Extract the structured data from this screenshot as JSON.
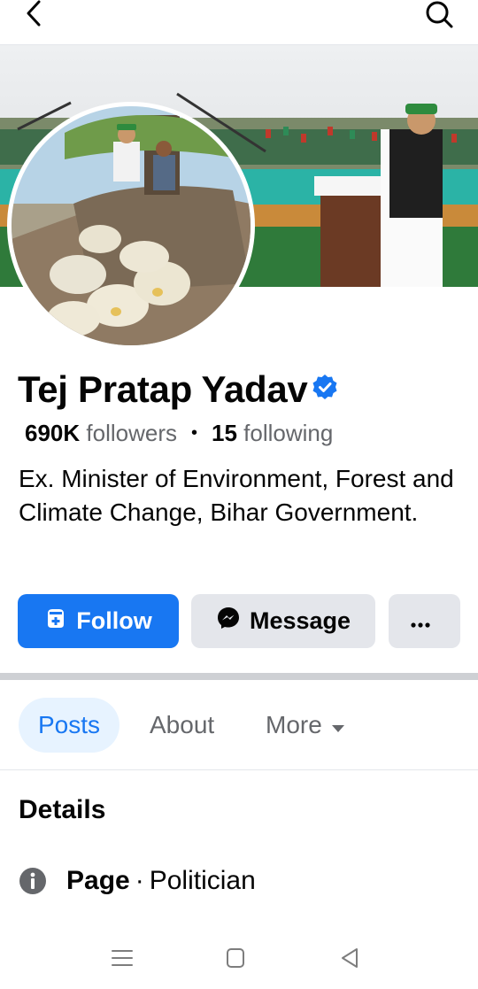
{
  "profile": {
    "name": "Tej Pratap Yadav",
    "followers_count": "690K",
    "followers_label": "followers",
    "following_count": "15",
    "following_label": "following",
    "separator": "•",
    "bio": "Ex. Minister of Environment, Forest and Climate Change, Bihar Government."
  },
  "actions": {
    "follow_label": "Follow",
    "message_label": "Message"
  },
  "tabs": [
    {
      "label": "Posts",
      "active": true
    },
    {
      "label": "About",
      "active": false
    },
    {
      "label": "More",
      "active": false
    }
  ],
  "details": {
    "title": "Details",
    "category_label": "Page",
    "category_separator": "·",
    "category_value": "Politician"
  },
  "colors": {
    "accent": "#1877f2",
    "button_gray": "#e4e6eb",
    "secondary_text": "#65676b"
  }
}
